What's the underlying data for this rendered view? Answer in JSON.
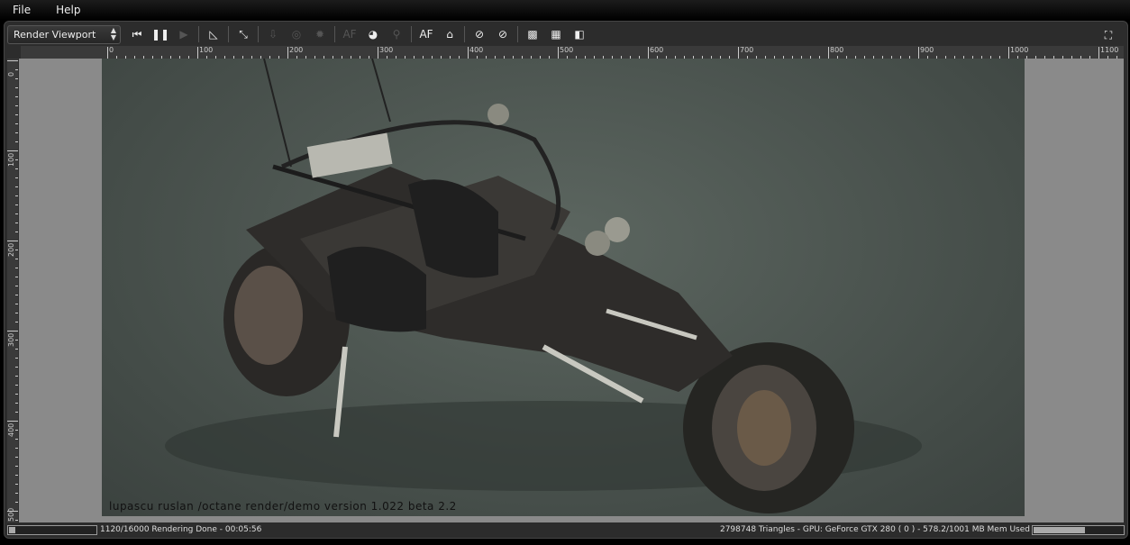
{
  "menubar": {
    "items": [
      "File",
      "Help"
    ]
  },
  "toolbar": {
    "view_select": "Render Viewport",
    "buttons": [
      {
        "name": "restart-render-button",
        "icon": "skip-back-icon",
        "glyph": "⏮",
        "enabled": true
      },
      {
        "name": "pause-render-button",
        "icon": "pause-icon",
        "glyph": "❚❚",
        "enabled": true
      },
      {
        "name": "start-render-button",
        "icon": "play-icon",
        "glyph": "▶",
        "enabled": false
      },
      {
        "name": "sep"
      },
      {
        "name": "ruler-button",
        "icon": "triangle-ruler-icon",
        "glyph": "◺",
        "enabled": true
      },
      {
        "name": "sep"
      },
      {
        "name": "fit-view-button",
        "icon": "fit-view-icon",
        "glyph": "⤡",
        "enabled": true
      },
      {
        "name": "sep"
      },
      {
        "name": "export-button",
        "icon": "export-icon",
        "glyph": "⇩",
        "enabled": false
      },
      {
        "name": "pick-target-button",
        "icon": "target-icon",
        "glyph": "◎",
        "enabled": false
      },
      {
        "name": "pick-light-button",
        "icon": "sun-icon",
        "glyph": "✹",
        "enabled": false
      },
      {
        "name": "sep"
      },
      {
        "name": "autofocus-pick-button",
        "icon": "af-picker-icon",
        "glyph": "AF",
        "enabled": false
      },
      {
        "name": "material-picker-button",
        "icon": "material-picker-icon",
        "glyph": "◕",
        "enabled": true
      },
      {
        "name": "focus-picker-button",
        "icon": "focus-picker-icon",
        "glyph": "⚲",
        "enabled": false
      },
      {
        "name": "sep"
      },
      {
        "name": "autofocus-button",
        "icon": "af-icon",
        "glyph": "AF",
        "enabled": true
      },
      {
        "name": "stereo-button",
        "icon": "anaglyph-glasses-icon",
        "glyph": "⌂",
        "enabled": true
      },
      {
        "name": "sep"
      },
      {
        "name": "region-render-button",
        "icon": "region-sphere-icon",
        "glyph": "⊘",
        "enabled": true
      },
      {
        "name": "clear-region-button",
        "icon": "clear-region-icon",
        "glyph": "⊘",
        "enabled": true
      },
      {
        "name": "sep"
      },
      {
        "name": "background-gray-button",
        "icon": "gray-pattern-icon",
        "glyph": "▩",
        "enabled": true
      },
      {
        "name": "background-checker-button",
        "icon": "checker-icon",
        "glyph": "▦",
        "enabled": true
      },
      {
        "name": "background-black-white-button",
        "icon": "black-white-icon",
        "glyph": "◧",
        "enabled": true
      }
    ],
    "fullscreen_icon": "fullscreen-icon"
  },
  "rulers": {
    "horizontal_labels": [
      "0",
      "100",
      "200",
      "300",
      "400",
      "500",
      "600",
      "700",
      "800",
      "900",
      "1000",
      "1100"
    ],
    "vertical_labels": [
      "0",
      "100",
      "200",
      "300",
      "400",
      "500"
    ]
  },
  "render": {
    "watermark": "lupascu ruslan /octane render/demo version 1.022 beta 2.2"
  },
  "status": {
    "left_text": "1120/16000 Rendering Done - 00:05:56",
    "render_progress": 0.07,
    "right_text": "2798748 Triangles - GPU: GeForce GTX 280 ( 0 ) - 578.2/1001 MB Mem Used",
    "memory_fraction": 0.578
  }
}
